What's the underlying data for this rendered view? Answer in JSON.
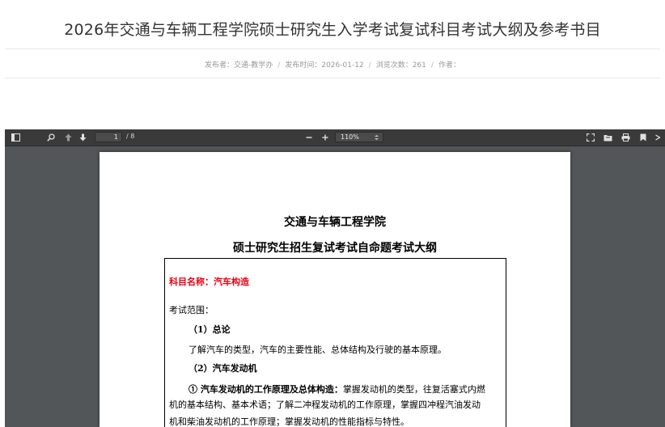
{
  "article": {
    "title": "2026年交通与车辆工程学院硕士研究生入学考试复试科目考试大纲及参考书目",
    "meta": {
      "publisher": "发布者：交通-教学办",
      "time": "发布时间：2026-01-12",
      "views": "浏览次数：261",
      "author": "作者："
    },
    "separator": "/"
  },
  "viewer": {
    "page_current": "1",
    "page_total": "/ 8",
    "zoom": "110%",
    "icons": {
      "left": [
        "sidebar-toggle-icon",
        "search-icon",
        "arrow-up-icon",
        "arrow-down-icon"
      ],
      "zoom": [
        "zoom-out-icon",
        "zoom-in-icon"
      ],
      "right": [
        "fullscreen-icon",
        "open-file-icon",
        "print-icon",
        "bookmark-icon",
        "more-tools-icon"
      ]
    }
  },
  "document": {
    "heading1": "交通与车辆工程学院",
    "heading2": "硕士研究生招生复试考试自命题考试大纲",
    "subject": "科目名称：汽车构造",
    "scope": "考试范围：",
    "section1_title": "（1）总论",
    "section1_body": "了解汽车的类型，汽车的主要性能、总体结构及行驶的基本原理。",
    "section2_title": "（2）汽车发动机",
    "item1_title": "① 汽车发动机的工作原理及总体构造：",
    "item1_text": "掌握发动机的类型，往复活塞式内燃",
    "item1_line2": "机的基本结构、基本术语；了解二冲程发动机的工作原理，掌握四冲程汽油发动",
    "item1_line3": "机和柴油发动机的工作原理；掌握发动机的性能指标与特性。"
  },
  "colors": {
    "toolbar": "#3a3a3a",
    "viewer_bg": "#525659",
    "subject_red": "#e60012"
  }
}
